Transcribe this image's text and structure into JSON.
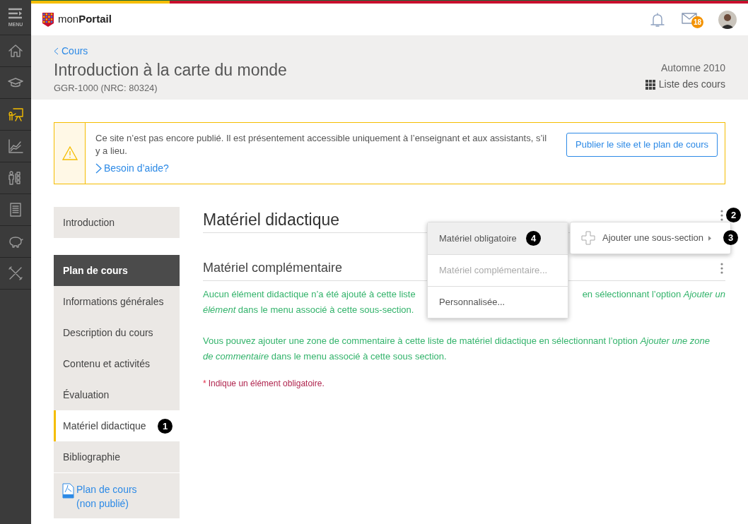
{
  "top_bar": {
    "menu_label": "MENU",
    "logo_light": "mon",
    "logo_bold": "Portail",
    "mail_count": "18"
  },
  "nav_rail": [
    {
      "kind": "home",
      "selected": false
    },
    {
      "kind": "cap",
      "selected": false
    },
    {
      "kind": "teacher",
      "selected": true
    },
    {
      "kind": "chart",
      "selected": false
    },
    {
      "kind": "people",
      "selected": false
    },
    {
      "kind": "document",
      "selected": false
    },
    {
      "kind": "piggy",
      "selected": false
    },
    {
      "kind": "tools",
      "selected": false
    }
  ],
  "header": {
    "back_link": "Cours",
    "title": "Introduction à la carte du monde",
    "code": "GGR-1000 (NRC: 80324)",
    "term": "Automne 2010",
    "course_list_link": "Liste des cours"
  },
  "alert": {
    "message": "Ce site n’est pas encore publié. Il est présentement accessible uniquement à l’enseignant et aux assistants, s’il y a lieu.",
    "help_link": "Besoin d’aide?",
    "button": "Publier le site et le plan de cours"
  },
  "course_nav": [
    {
      "kind": "item",
      "label": "Introduction",
      "selected": false
    },
    {
      "kind": "heading",
      "label": "Plan de cours",
      "selected": false
    },
    {
      "kind": "item",
      "label": "Informations générales",
      "selected": false
    },
    {
      "kind": "item",
      "label": "Description du cours",
      "selected": false
    },
    {
      "kind": "item",
      "label": "Contenu et activités",
      "selected": false
    },
    {
      "kind": "item",
      "label": "Évaluation",
      "selected": false
    },
    {
      "kind": "item",
      "label": "Matériel didactique",
      "selected": true,
      "callout": "1"
    },
    {
      "kind": "item",
      "label": "Bibliographie",
      "selected": false
    },
    {
      "kind": "pdf",
      "lines": [
        "Plan de cours",
        "(non publié)"
      ],
      "selected": false
    }
  ],
  "section": {
    "title": "Matériel didactique",
    "callout": "2",
    "subsection": "Matériel complémentaire",
    "paragraph_1_lines": [
      [
        "Aucun élément didactique n’a été ajouté à cette liste",
        "en sélectionnant l’option *Ajouter un*"
      ],
      [
        "*élément* dans le menu associé à cette sous-section."
      ]
    ],
    "paragraph_2": "Vous pouvez ajouter une zone de commentaire à cette liste de matériel didactique en sélectionnant l’option *Ajouter une zone de commentaire* dans le menu associé à cette sous section.",
    "required_mark": "*",
    "required_note": "Indique un élément obligatoire."
  },
  "submenu": {
    "label": "Ajouter une sous-section",
    "callout": "3"
  },
  "dropdown": [
    {
      "label": "Matériel obligatoire",
      "selected": true,
      "disabled": false,
      "callout": "4"
    },
    {
      "label": "Matériel complémentaire...",
      "selected": false,
      "disabled": true
    },
    {
      "label": "Personnalisée...",
      "selected": false,
      "disabled": false
    }
  ]
}
